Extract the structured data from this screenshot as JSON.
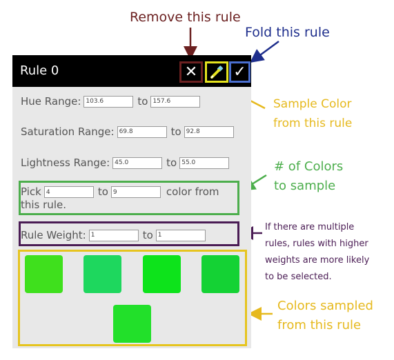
{
  "annotations": {
    "remove": "Remove this rule",
    "fold": "Fold this rule",
    "sample_line1": "Sample Color",
    "sample_line2": "from this rule",
    "num_line1": "# of Colors",
    "num_line2": "to sample",
    "weight_line1": "If there are multiple",
    "weight_line2": "rules, rules with higher",
    "weight_line3": "weights are more likely",
    "weight_line4": "to be selected.",
    "colors_line1": "Colors sampled",
    "colors_line2": "from this rule"
  },
  "annotation_colors": {
    "remove": "#6b2020",
    "fold": "#1e2e8c",
    "sample": "#e6b91e",
    "num": "#4cae4c",
    "weight": "#4a1c54",
    "colors": "#e6b91e"
  },
  "rule": {
    "title": "Rule 0",
    "remove_icon": "x-icon",
    "sample_icon": "eyedropper-icon",
    "fold_icon": "checkmark-icon",
    "hue": {
      "label": "Hue Range:",
      "min": "103.6",
      "sep": "to",
      "max": "157.6"
    },
    "saturation": {
      "label": "Saturation Range:",
      "min": "69.8",
      "sep": "to",
      "max": "92.8"
    },
    "lightness": {
      "label": "Lightness Range:",
      "min": "45.0",
      "sep": "to",
      "max": "55.0"
    },
    "pick": {
      "label": "Pick",
      "min": "4",
      "sep": "to",
      "max": "9",
      "suffix_line1": "color from",
      "suffix_line2": "this rule."
    },
    "weight": {
      "label": "Rule Weight:",
      "min": "1",
      "sep": "to",
      "max": "1"
    }
  },
  "swatches": [
    "#3fe01d",
    "#1ed75e",
    "#0de31b",
    "#14d234",
    "#22e02a"
  ]
}
